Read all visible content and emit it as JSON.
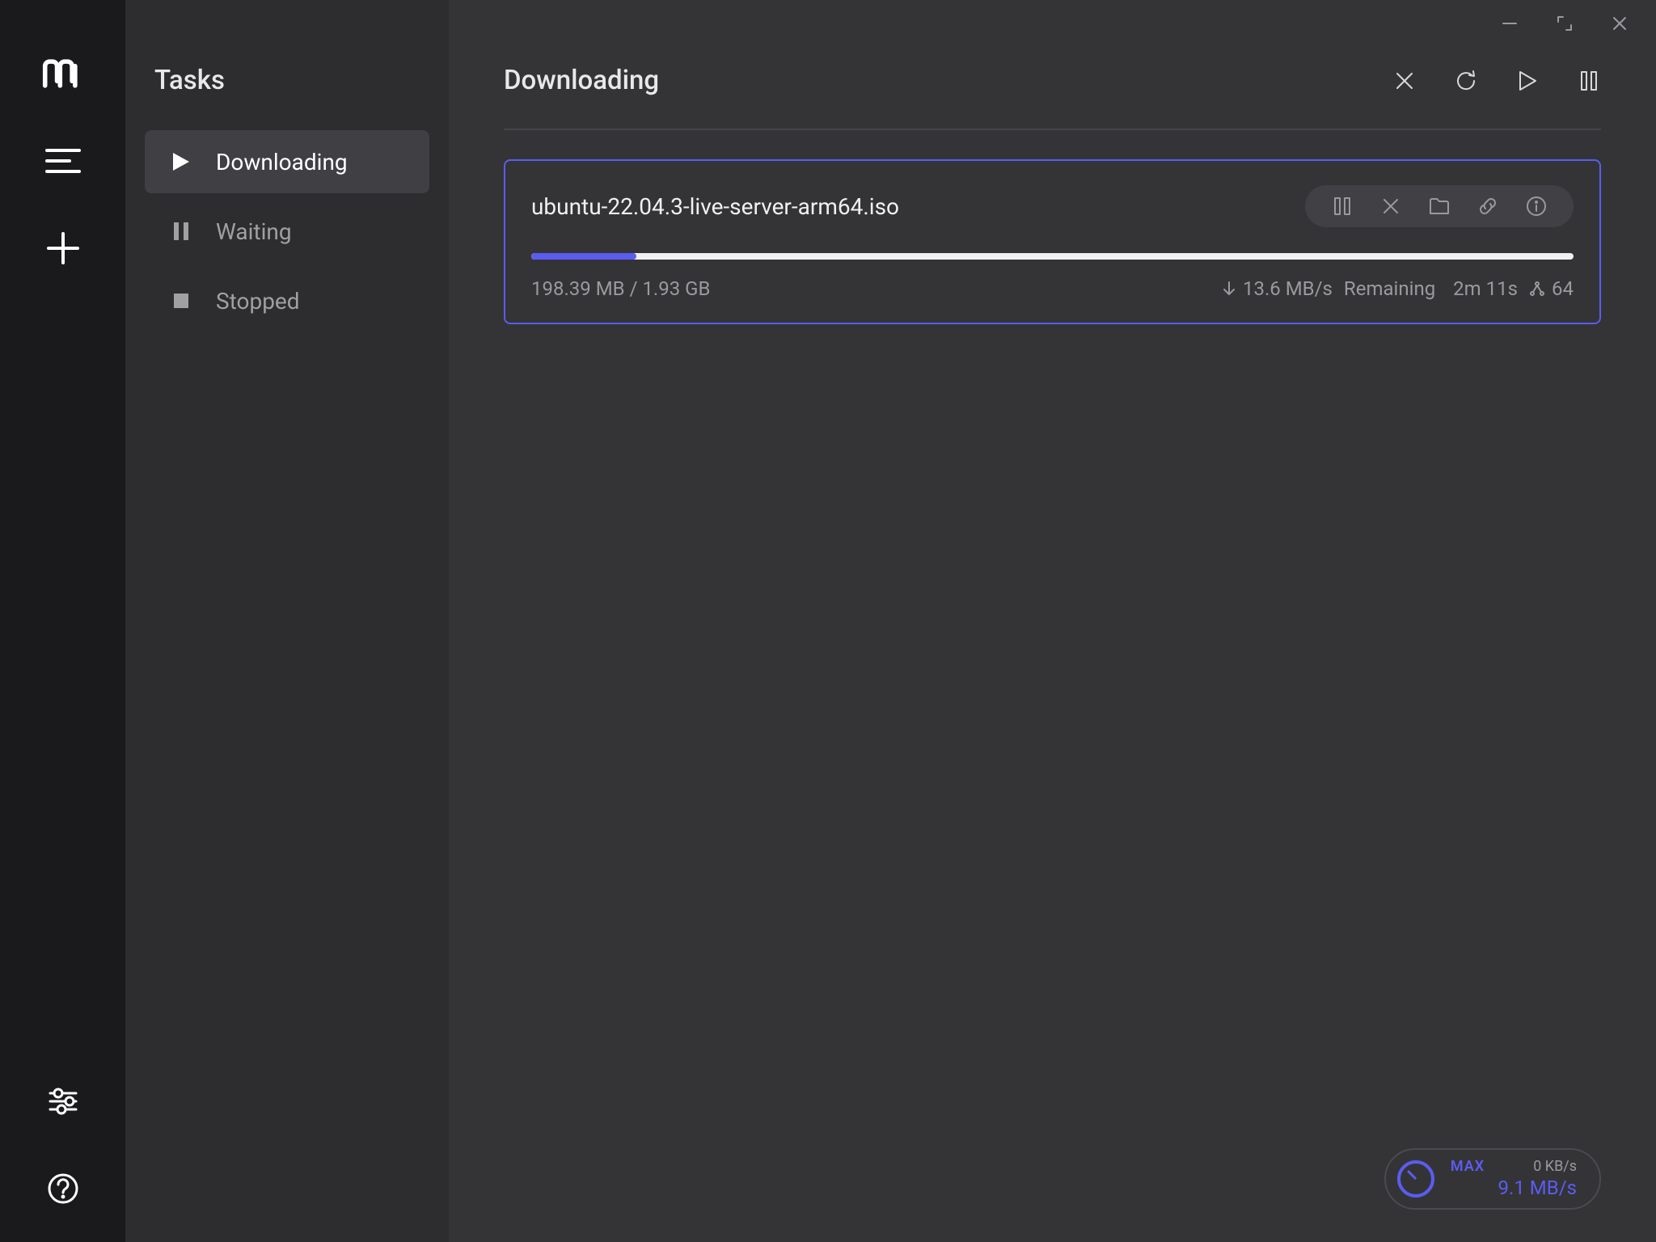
{
  "sidebar": {
    "title": "Tasks",
    "items": [
      {
        "label": "Downloading",
        "icon": "play-icon",
        "active": true
      },
      {
        "label": "Waiting",
        "icon": "pause-icon",
        "active": false
      },
      {
        "label": "Stopped",
        "icon": "stop-icon",
        "active": false
      }
    ]
  },
  "main": {
    "title": "Downloading",
    "actions": {
      "cancel": "Cancel",
      "refresh": "Refresh",
      "resume": "Resume",
      "pause": "Pause"
    }
  },
  "task": {
    "filename": "ubuntu-22.04.3-live-server-arm64.iso",
    "downloaded": "198.39 MB",
    "total": "1.93 GB",
    "size_text": "198.39 MB / 1.93 GB",
    "speed": "13.6 MB/s",
    "remaining_label": "Remaining",
    "remaining": "2m 11s",
    "connections": "64",
    "progress_percent": 10.05
  },
  "speed_badge": {
    "max_label": "MAX",
    "upload": "0 KB/s",
    "download": "9.1 MB/s"
  },
  "colors": {
    "accent": "#5b5cf1",
    "bg_main": "#343437",
    "bg_sidebar": "#2d2d30",
    "bg_iconbar": "#1a1a1c"
  }
}
